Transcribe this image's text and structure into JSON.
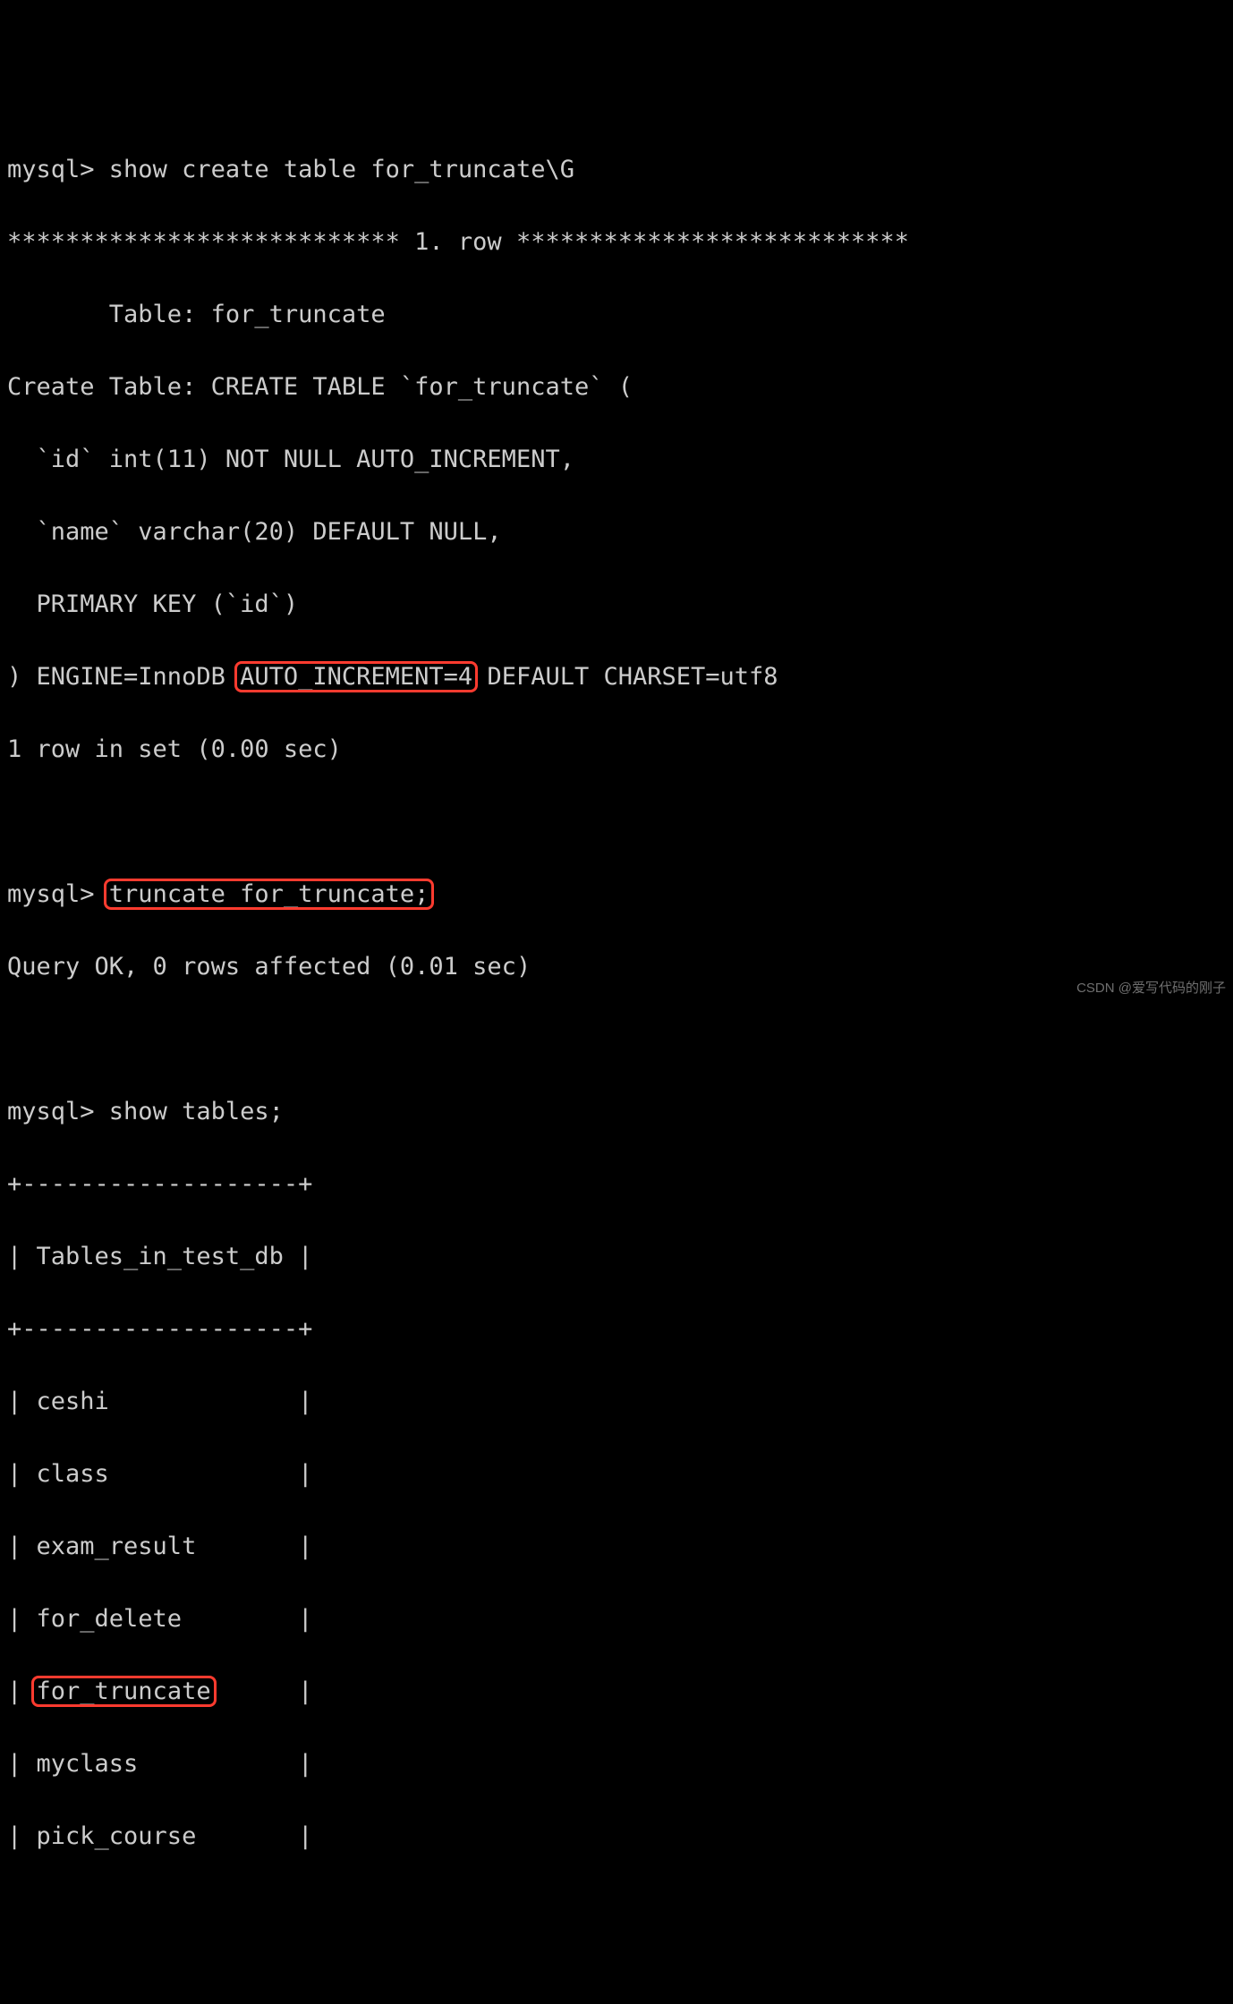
{
  "prompt": "mysql> ",
  "cmds": {
    "show_create": "show create table for_truncate\\G",
    "truncate": "truncate for_truncate;",
    "show_tables": "show tables;"
  },
  "create_output": {
    "row_sep_left": "*************************** ",
    "row_num": "1. row",
    "row_sep_right": " ***************************",
    "table_label": "       Table: ",
    "table_name": "for_truncate",
    "ct_label": "Create Table: ",
    "ct_head": "CREATE TABLE `for_truncate` (",
    "col_id": "  `id` int(11) NOT NULL AUTO_INCREMENT,",
    "col_name": "  `name` varchar(20) DEFAULT NULL,",
    "pk": "  PRIMARY KEY (`id`)",
    "engine_pre": ") ENGINE=InnoDB ",
    "auto_inc": "AUTO_INCREMENT=4",
    "engine_post": " DEFAULT CHARSET=utf8",
    "rows_in_set": "1 row in set (0.00 sec)"
  },
  "truncate_result": "Query OK, 0 rows affected (0.01 sec)",
  "tables_output": {
    "border": "+-------------------+",
    "header": "| Tables_in_test_db |",
    "rows": [
      "| ceshi             |",
      "| class             |",
      "| exam_result       |",
      "| for_delete        |",
      "| for_truncate      |",
      "| myclass           |",
      "| pick_course       |"
    ],
    "highlight_pre": "| ",
    "highlight_name": "for_truncate",
    "highlight_post": "      |"
  },
  "watermark": "CSDN @爱写代码的刚子"
}
